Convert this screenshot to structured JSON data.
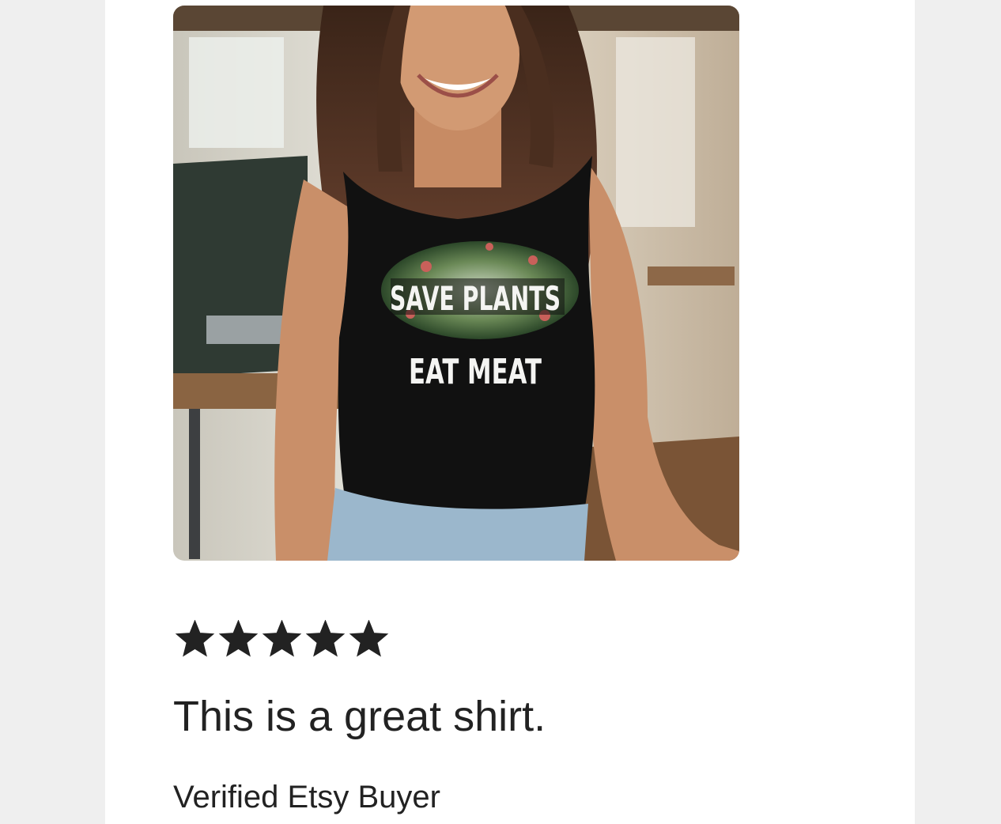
{
  "review": {
    "image": {
      "alt": "Woman wearing black tank top",
      "print_line_1": "SAVE PLANTS",
      "print_line_2": "EAT MEAT"
    },
    "rating": 5,
    "rating_max": 5,
    "text": "This is a great shirt.",
    "reviewer": "Verified Etsy Buyer"
  },
  "colors": {
    "page_background": "#efefef",
    "card_background": "#ffffff",
    "text": "#222222",
    "star": "#222222"
  },
  "icons": {
    "rating": "star-icon"
  }
}
